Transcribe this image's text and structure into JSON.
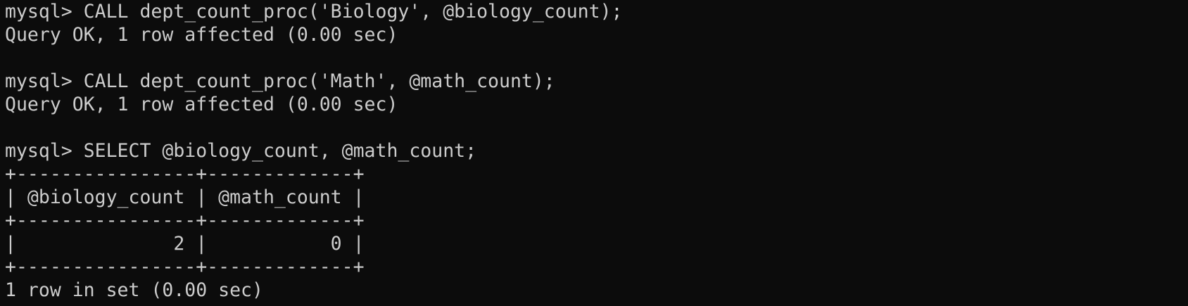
{
  "terminal": {
    "background_color": "#0c0c0c",
    "text_color": "#cccccc",
    "lines": [
      "mysql> CALL dept_count_proc('Biology', @biology_count);",
      "Query OK, 1 row affected (0.00 sec)",
      "",
      "mysql> CALL dept_count_proc('Math', @math_count);",
      "Query OK, 1 row affected (0.00 sec)",
      "",
      "mysql> SELECT @biology_count, @math_count;",
      "+----------------+-------------+",
      "| @biology_count | @math_count |",
      "+----------------+-------------+",
      "|              2 |           0 |",
      "+----------------+-------------+",
      "1 row in set (0.00 sec)"
    ]
  }
}
